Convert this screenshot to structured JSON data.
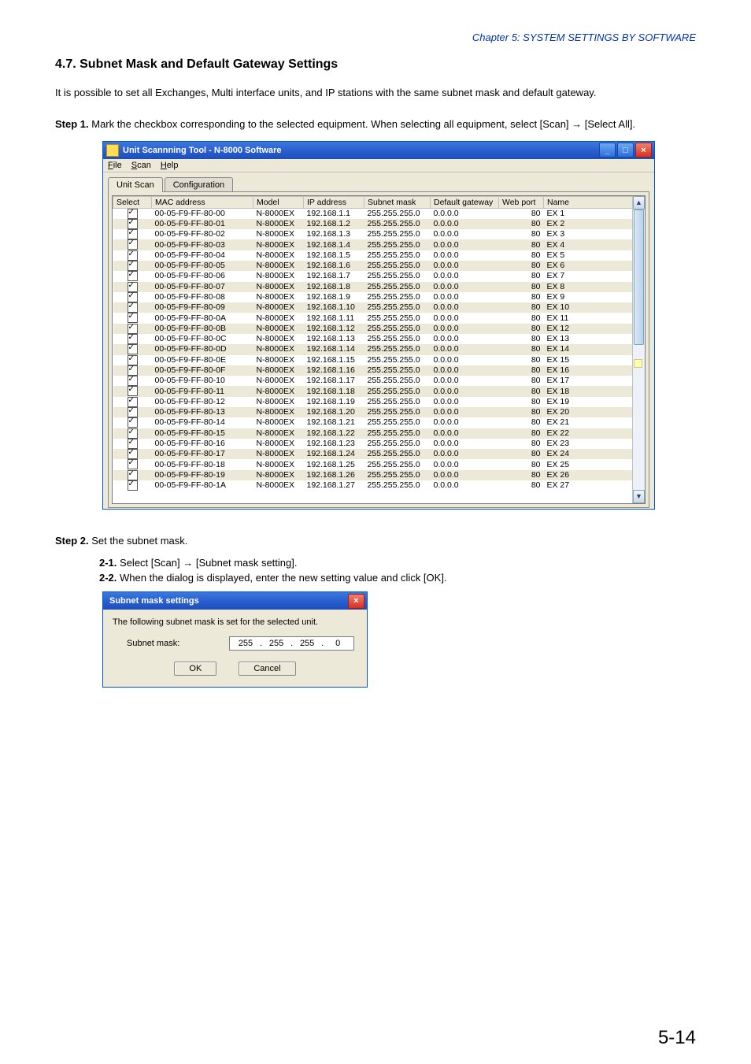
{
  "chapter_header": "Chapter 5:  SYSTEM SETTINGS BY SOFTWARE",
  "section_title": "4.7. Subnet Mask and Default Gateway Settings",
  "intro": "It is possible to set all Exchanges, Multi interface units, and IP stations with the same subnet mask and default gateway.",
  "step1_label": "Step 1.",
  "step1_text": "Mark the checkbox corresponding to the selected equipment. When selecting all equipment, select [Scan] → [Select All].",
  "win": {
    "title": "Unit Scannning Tool - N-8000 Software",
    "menu": {
      "file": "File",
      "scan": "Scan",
      "help": "Help"
    },
    "tabs": {
      "unit_scan": "Unit Scan",
      "configuration": "Configuration"
    },
    "headers": {
      "select": "Select",
      "mac": "MAC address",
      "model": "Model",
      "ip": "IP address",
      "mask": "Subnet mask",
      "gw": "Default gateway",
      "port": "Web port",
      "name": "Name"
    },
    "rows": [
      {
        "mac": "00-05-F9-FF-80-00",
        "model": "N-8000EX",
        "ip": "192.168.1.1",
        "mask": "255.255.255.0",
        "gw": "0.0.0.0",
        "port": "80",
        "name": "EX 1"
      },
      {
        "mac": "00-05-F9-FF-80-01",
        "model": "N-8000EX",
        "ip": "192.168.1.2",
        "mask": "255.255.255.0",
        "gw": "0.0.0.0",
        "port": "80",
        "name": "EX 2"
      },
      {
        "mac": "00-05-F9-FF-80-02",
        "model": "N-8000EX",
        "ip": "192.168.1.3",
        "mask": "255.255.255.0",
        "gw": "0.0.0.0",
        "port": "80",
        "name": "EX 3"
      },
      {
        "mac": "00-05-F9-FF-80-03",
        "model": "N-8000EX",
        "ip": "192.168.1.4",
        "mask": "255.255.255.0",
        "gw": "0.0.0.0",
        "port": "80",
        "name": "EX 4"
      },
      {
        "mac": "00-05-F9-FF-80-04",
        "model": "N-8000EX",
        "ip": "192.168.1.5",
        "mask": "255.255.255.0",
        "gw": "0.0.0.0",
        "port": "80",
        "name": "EX 5"
      },
      {
        "mac": "00-05-F9-FF-80-05",
        "model": "N-8000EX",
        "ip": "192.168.1.6",
        "mask": "255.255.255.0",
        "gw": "0.0.0.0",
        "port": "80",
        "name": "EX 6"
      },
      {
        "mac": "00-05-F9-FF-80-06",
        "model": "N-8000EX",
        "ip": "192.168.1.7",
        "mask": "255.255.255.0",
        "gw": "0.0.0.0",
        "port": "80",
        "name": "EX 7"
      },
      {
        "mac": "00-05-F9-FF-80-07",
        "model": "N-8000EX",
        "ip": "192.168.1.8",
        "mask": "255.255.255.0",
        "gw": "0.0.0.0",
        "port": "80",
        "name": "EX 8"
      },
      {
        "mac": "00-05-F9-FF-80-08",
        "model": "N-8000EX",
        "ip": "192.168.1.9",
        "mask": "255.255.255.0",
        "gw": "0.0.0.0",
        "port": "80",
        "name": "EX 9"
      },
      {
        "mac": "00-05-F9-FF-80-09",
        "model": "N-8000EX",
        "ip": "192.168.1.10",
        "mask": "255.255.255.0",
        "gw": "0.0.0.0",
        "port": "80",
        "name": "EX 10"
      },
      {
        "mac": "00-05-F9-FF-80-0A",
        "model": "N-8000EX",
        "ip": "192.168.1.11",
        "mask": "255.255.255.0",
        "gw": "0.0.0.0",
        "port": "80",
        "name": "EX 11"
      },
      {
        "mac": "00-05-F9-FF-80-0B",
        "model": "N-8000EX",
        "ip": "192.168.1.12",
        "mask": "255.255.255.0",
        "gw": "0.0.0.0",
        "port": "80",
        "name": "EX 12"
      },
      {
        "mac": "00-05-F9-FF-80-0C",
        "model": "N-8000EX",
        "ip": "192.168.1.13",
        "mask": "255.255.255.0",
        "gw": "0.0.0.0",
        "port": "80",
        "name": "EX 13"
      },
      {
        "mac": "00-05-F9-FF-80-0D",
        "model": "N-8000EX",
        "ip": "192.168.1.14",
        "mask": "255.255.255.0",
        "gw": "0.0.0.0",
        "port": "80",
        "name": "EX 14"
      },
      {
        "mac": "00-05-F9-FF-80-0E",
        "model": "N-8000EX",
        "ip": "192.168.1.15",
        "mask": "255.255.255.0",
        "gw": "0.0.0.0",
        "port": "80",
        "name": "EX 15"
      },
      {
        "mac": "00-05-F9-FF-80-0F",
        "model": "N-8000EX",
        "ip": "192.168.1.16",
        "mask": "255.255.255.0",
        "gw": "0.0.0.0",
        "port": "80",
        "name": "EX 16"
      },
      {
        "mac": "00-05-F9-FF-80-10",
        "model": "N-8000EX",
        "ip": "192.168.1.17",
        "mask": "255.255.255.0",
        "gw": "0.0.0.0",
        "port": "80",
        "name": "EX 17"
      },
      {
        "mac": "00-05-F9-FF-80-11",
        "model": "N-8000EX",
        "ip": "192.168.1.18",
        "mask": "255.255.255.0",
        "gw": "0.0.0.0",
        "port": "80",
        "name": "EX 18"
      },
      {
        "mac": "00-05-F9-FF-80-12",
        "model": "N-8000EX",
        "ip": "192.168.1.19",
        "mask": "255.255.255.0",
        "gw": "0.0.0.0",
        "port": "80",
        "name": "EX 19"
      },
      {
        "mac": "00-05-F9-FF-80-13",
        "model": "N-8000EX",
        "ip": "192.168.1.20",
        "mask": "255.255.255.0",
        "gw": "0.0.0.0",
        "port": "80",
        "name": "EX 20"
      },
      {
        "mac": "00-05-F9-FF-80-14",
        "model": "N-8000EX",
        "ip": "192.168.1.21",
        "mask": "255.255.255.0",
        "gw": "0.0.0.0",
        "port": "80",
        "name": "EX 21"
      },
      {
        "mac": "00-05-F9-FF-80-15",
        "model": "N-8000EX",
        "ip": "192.168.1.22",
        "mask": "255.255.255.0",
        "gw": "0.0.0.0",
        "port": "80",
        "name": "EX 22"
      },
      {
        "mac": "00-05-F9-FF-80-16",
        "model": "N-8000EX",
        "ip": "192.168.1.23",
        "mask": "255.255.255.0",
        "gw": "0.0.0.0",
        "port": "80",
        "name": "EX 23"
      },
      {
        "mac": "00-05-F9-FF-80-17",
        "model": "N-8000EX",
        "ip": "192.168.1.24",
        "mask": "255.255.255.0",
        "gw": "0.0.0.0",
        "port": "80",
        "name": "EX 24"
      },
      {
        "mac": "00-05-F9-FF-80-18",
        "model": "N-8000EX",
        "ip": "192.168.1.25",
        "mask": "255.255.255.0",
        "gw": "0.0.0.0",
        "port": "80",
        "name": "EX 25"
      },
      {
        "mac": "00-05-F9-FF-80-19",
        "model": "N-8000EX",
        "ip": "192.168.1.26",
        "mask": "255.255.255.0",
        "gw": "0.0.0.0",
        "port": "80",
        "name": "EX 26"
      },
      {
        "mac": "00-05-F9-FF-80-1A",
        "model": "N-8000EX",
        "ip": "192.168.1.27",
        "mask": "255.255.255.0",
        "gw": "0.0.0.0",
        "port": "80",
        "name": "EX 27"
      }
    ]
  },
  "step2_label": "Step 2.",
  "step2_text": "Set the subnet mask.",
  "step2_1_label": "2-1.",
  "step2_1_text": "Select [Scan] → [Subnet mask setting].",
  "step2_2_label": "2-2.",
  "step2_2_text": "When the dialog is displayed, enter the new setting value and click [OK].",
  "dialog": {
    "title": "Subnet mask settings",
    "desc": "The following subnet mask is set for the selected unit.",
    "label": "Subnet mask:",
    "ip": [
      "255",
      "255",
      "255",
      "0"
    ],
    "ok": "OK",
    "cancel": "Cancel"
  },
  "page_number": "5-14"
}
